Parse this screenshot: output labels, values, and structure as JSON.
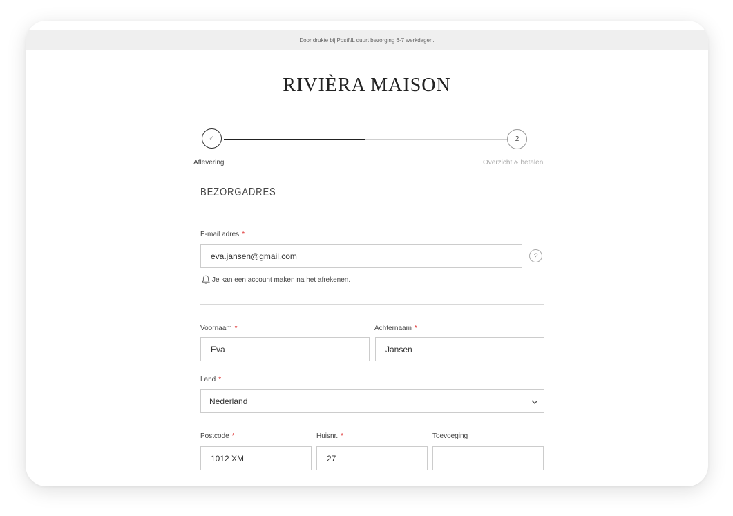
{
  "banner": {
    "text": "Door drukte bij PostNL duurt bezorging 6-7 werkdagen."
  },
  "brand": {
    "name": "RIVIÈRA MAISON"
  },
  "steps": [
    {
      "label": "Aflevering",
      "indicator": "✓"
    },
    {
      "label": "Overzicht & betalen",
      "indicator": "2"
    }
  ],
  "section": {
    "title": "BEZORGADRES"
  },
  "form": {
    "email": {
      "label": "E-mail adres",
      "required": "*",
      "value": "eva.jansen@gmail.com",
      "help": "?"
    },
    "account_note": "Je kan een account maken na het afrekenen.",
    "first_name": {
      "label": "Voornaam",
      "required": "*",
      "value": "Eva"
    },
    "last_name": {
      "label": "Achternaam",
      "required": "*",
      "value": "Jansen"
    },
    "country": {
      "label": "Land",
      "required": "*",
      "value": "Nederland"
    },
    "postcode": {
      "label": "Postcode",
      "required": "*",
      "value": "1012 XM"
    },
    "house_number": {
      "label": "Huisnr.",
      "required": "*",
      "value": "27"
    },
    "addition": {
      "label": "Toevoeging",
      "value": ""
    }
  },
  "colors": {
    "required": "#dd2222",
    "banner_bg": "#efefef",
    "progress_done": "#222222",
    "progress_todo": "#cfcfcf"
  }
}
